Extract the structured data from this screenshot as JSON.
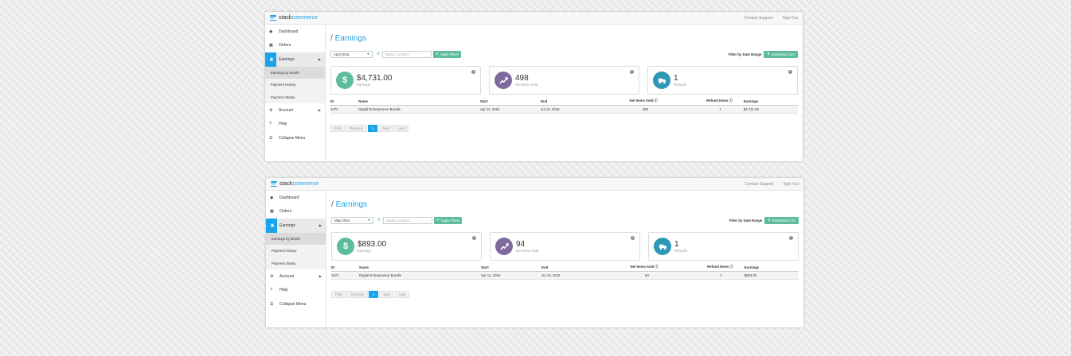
{
  "brand": {
    "part1": "stack",
    "part2": "commerce"
  },
  "topnav": {
    "contact": "Contact Support",
    "signout": "Sign Out"
  },
  "sidebar": {
    "items": [
      {
        "label": "Dashboard",
        "icon": "dashboard-icon"
      },
      {
        "label": "Orders",
        "icon": "orders-icon"
      },
      {
        "label": "Earnings",
        "icon": "earnings-icon"
      }
    ],
    "sub": [
      "Earnings by Month",
      "Payment History",
      "Payment Status"
    ],
    "items2": [
      {
        "label": "Account",
        "icon": "gear-icon"
      },
      {
        "label": "Help",
        "icon": "question-icon"
      },
      {
        "label": "Collapse Menu",
        "icon": "list-icon"
      }
    ]
  },
  "page": {
    "title_slash": "/",
    "title": "Earnings",
    "search_placeholder": "Name Contains",
    "apply": "Apply Filters",
    "filter_range": "Filter by Date Range",
    "csv": "Download CSV",
    "cards": {
      "items_label": "Net Items Sold",
      "earnings_label": "Earnings",
      "refunds_label": "Refunds"
    },
    "columns": [
      "ID",
      "Name",
      "Start",
      "End",
      "Net Items Sold",
      "Refund Items",
      "Earnings"
    ],
    "pager": [
      "First",
      "Previous",
      "1",
      "Next",
      "Last"
    ]
  },
  "panels": [
    {
      "month": "April 2016",
      "earnings": "$4,731.00",
      "items": "498",
      "refunds": "1",
      "row": [
        "3472",
        "Digital Entrepreneur Bundle",
        "Apr 12, 2016",
        "Jul 12, 2016",
        "498",
        "1",
        "$4,731.00"
      ]
    },
    {
      "month": "May 2016",
      "earnings": "$893.00",
      "items": "94",
      "refunds": "1",
      "row": [
        "3472",
        "Digital Entrepreneur Bundle",
        "Apr 12, 2016",
        "Jul 12, 2016",
        "94",
        "1",
        "$893.00"
      ]
    }
  ],
  "colors": {
    "accent": "#1aa3e8",
    "green": "#5dbc99",
    "purple": "#7e6a9e",
    "teal": "#2e97b6",
    "money": "#5dbc99"
  }
}
